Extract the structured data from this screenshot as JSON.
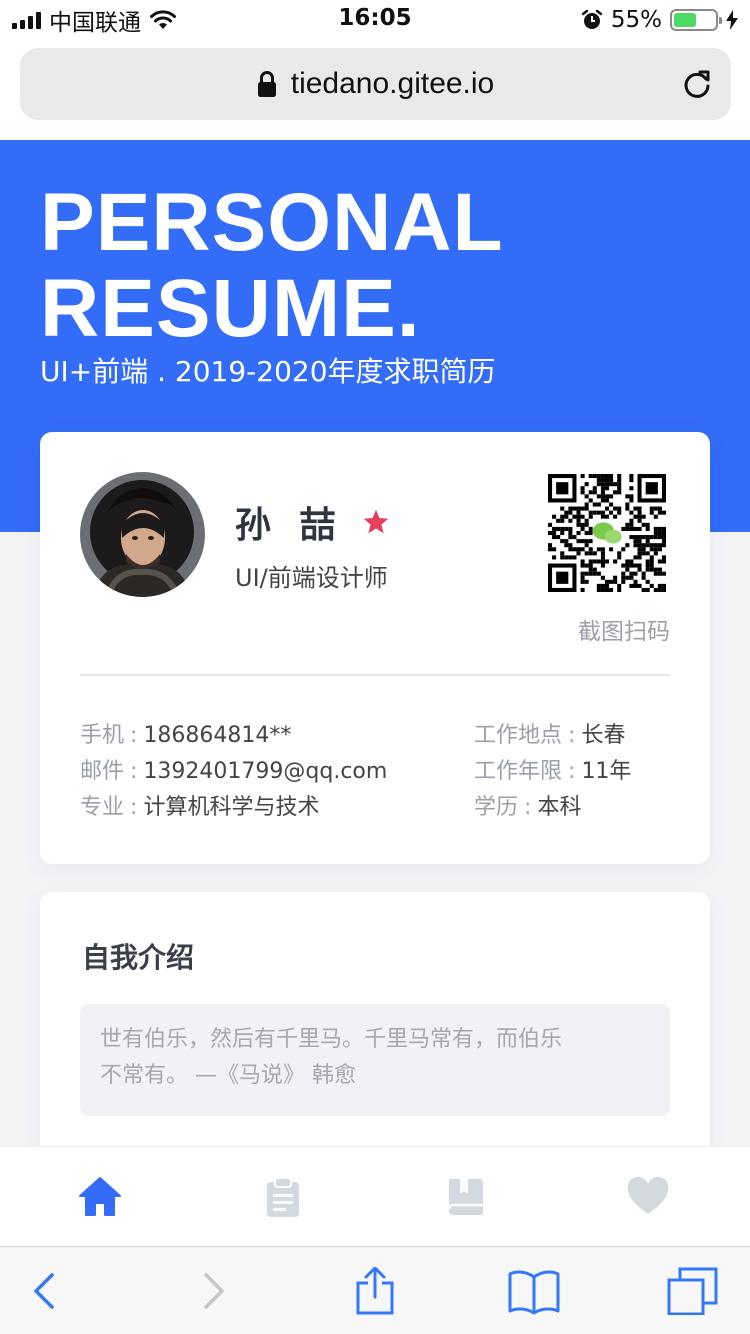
{
  "status_bar": {
    "carrier": "中国联通",
    "time": "16:05",
    "battery_percent": "55%",
    "battery_level": 0.55,
    "icons": [
      "signal-icon",
      "wifi-icon",
      "alarm-icon",
      "battery-icon",
      "charging-bolt-icon"
    ]
  },
  "browser": {
    "url": "tiedano.gitee.io",
    "icons": [
      "lock-icon",
      "reload-icon"
    ]
  },
  "hero": {
    "title_line1": "PERSONAL",
    "title_line2": "RESUME.",
    "subtitle": "UI+前端 . 2019-2020年度求职简历",
    "background_color": "#336cf6"
  },
  "profile": {
    "name": "孙 喆",
    "role": "UI/前端设计师",
    "qr_label": "截图扫码",
    "star_color": "#e8405a",
    "info_left": [
      {
        "key": "手机",
        "value": "186864814**"
      },
      {
        "key": "邮件",
        "value": "1392401799@qq.com"
      },
      {
        "key": "专业",
        "value": "计算机科学与技术"
      }
    ],
    "info_right": [
      {
        "key": "工作地点",
        "value": "长春"
      },
      {
        "key": "工作年限",
        "value": "11年"
      },
      {
        "key": "学历",
        "value": "本科"
      }
    ],
    "separator": ":"
  },
  "intro": {
    "title": "自我介绍",
    "quote_line1": "世有伯乐，然后有千里马。千里马常有，而伯乐",
    "quote_line2": "不常有。 —《马说》  韩愈"
  },
  "app_tabs": [
    {
      "icon": "home-icon",
      "active": true
    },
    {
      "icon": "clipboard-icon",
      "active": false
    },
    {
      "icon": "book-icon",
      "active": false
    },
    {
      "icon": "heart-icon",
      "active": false
    }
  ],
  "colors": {
    "accent": "#336cf6",
    "tab_inactive": "#d4d8df",
    "ios_blue": "#3478f6"
  },
  "safari_toolbar": {
    "icons": [
      "back-icon",
      "forward-icon",
      "share-icon",
      "bookmarks-icon",
      "tabs-icon"
    ]
  }
}
